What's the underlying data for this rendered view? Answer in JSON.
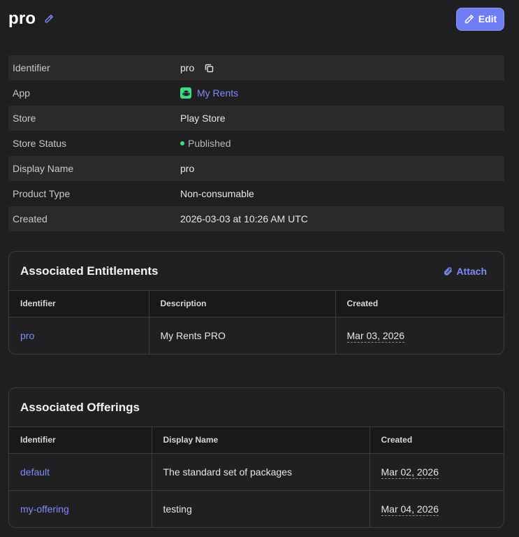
{
  "header": {
    "title": "pro",
    "edit_label": "Edit"
  },
  "details": [
    {
      "label": "Identifier",
      "value": "pro"
    },
    {
      "label": "App",
      "value": "My Rents"
    },
    {
      "label": "Store",
      "value": "Play Store"
    },
    {
      "label": "Store Status",
      "value": "Published"
    },
    {
      "label": "Display Name",
      "value": "pro"
    },
    {
      "label": "Product Type",
      "value": "Non-consumable"
    },
    {
      "label": "Created",
      "value": "2026-03-03 at 10:26 AM UTC"
    }
  ],
  "entitlements": {
    "title": "Associated Entitlements",
    "attach_label": "Attach",
    "columns": [
      "Identifier",
      "Description",
      "Created"
    ],
    "rows": [
      {
        "identifier": "pro",
        "description": "My Rents PRO",
        "created": "Mar 03, 2026"
      }
    ]
  },
  "offerings": {
    "title": "Associated Offerings",
    "columns": [
      "Identifier",
      "Display Name",
      "Created"
    ],
    "rows": [
      {
        "identifier": "default",
        "display_name": "The standard set of packages",
        "created": "Mar 02, 2026"
      },
      {
        "identifier": "my-offering",
        "display_name": "testing",
        "created": "Mar 04, 2026"
      }
    ]
  },
  "colors": {
    "accent": "#6f7cf2",
    "link": "#7f8cf6",
    "status_green": "#3ddc84",
    "background": "#1f1f21"
  },
  "icons": [
    "pencil-icon",
    "copy-icon",
    "android-icon",
    "paperclip-icon"
  ]
}
